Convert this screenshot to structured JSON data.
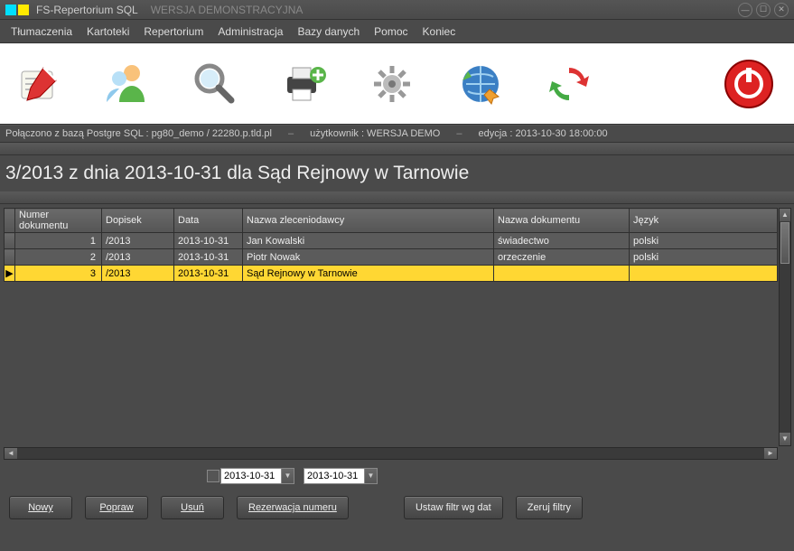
{
  "title": {
    "app": "FS-Repertorium SQL",
    "edition": "WERSJA DEMONSTRACYJNA"
  },
  "menu": {
    "items": [
      "Tłumaczenia",
      "Kartoteki",
      "Repertorium",
      "Administracja",
      "Bazy danych",
      "Pomoc",
      "Koniec"
    ]
  },
  "toolbar": {
    "icons": [
      "edit-icon",
      "person-icon",
      "search-icon",
      "print-icon",
      "gear-icon",
      "globe-icon",
      "sync-icon"
    ],
    "power": "power-icon"
  },
  "status": {
    "conn": "Połączono z bazą Postgre SQL  : pg80_demo / 22280.p.tld.pl",
    "user": "użytkownik : WERSJA DEMO",
    "edit": "edycja :  2013-10-30   18:00:00"
  },
  "heading": "3/2013 z dnia 2013-10-31 dla Sąd Rejnowy w Tarnowie",
  "table": {
    "columns": [
      "Numer dokumentu",
      "Dopisek",
      "Data",
      "Nazwa zleceniodawcy",
      "Nazwa dokumentu",
      "Język"
    ],
    "rows": [
      {
        "num": "1",
        "dop": "/2013",
        "data": "2013-10-31",
        "zlec": "Jan Kowalski",
        "dok": "świadectwo",
        "jez": "polski",
        "selected": false
      },
      {
        "num": "2",
        "dop": "/2013",
        "data": "2013-10-31",
        "zlec": "Piotr Nowak",
        "dok": "orzeczenie",
        "jez": "polski",
        "selected": false
      },
      {
        "num": "3",
        "dop": "/2013",
        "data": "2013-10-31",
        "zlec": "Sąd Rejnowy w Tarnowie",
        "dok": "",
        "jez": "",
        "selected": true
      }
    ]
  },
  "filters": {
    "date_from": "2013-10-31",
    "date_to": "2013-10-31"
  },
  "buttons": {
    "nowy": "Nowy",
    "popraw": "Popraw",
    "usun": "Usuń",
    "rezerw": "Rezerwacja numeru",
    "setfilter": "Ustaw filtr wg dat",
    "resetfilter": "Zeruj filtry"
  }
}
